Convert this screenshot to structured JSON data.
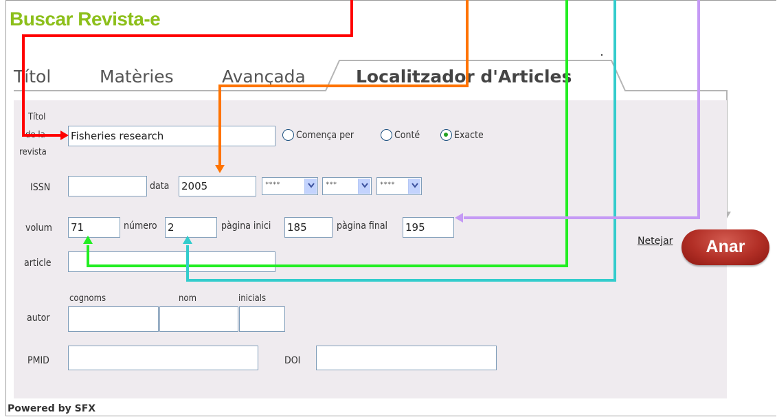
{
  "page": {
    "title": "Buscar Revista-e",
    "powered_by": "Powered by SFX"
  },
  "tabs": [
    {
      "label": "Títol",
      "active": false
    },
    {
      "label": "Matèries",
      "active": false
    },
    {
      "label": "Avançada",
      "active": false
    },
    {
      "label": "Localitzador d'Articles",
      "active": true
    }
  ],
  "form": {
    "journal_title": {
      "label_line1": "Títol",
      "label_line2": "de la",
      "label_line3": "revista",
      "value": "Fisheries research",
      "match_options": [
        "Comença per",
        "Conté",
        "Exacte"
      ],
      "match_selected": "Exacte"
    },
    "issn": {
      "label": "ISSN",
      "value": ""
    },
    "date": {
      "label": "data",
      "value": "2005",
      "year_select": "****",
      "month_select": "***",
      "day_select": "****"
    },
    "volume": {
      "label": "volum",
      "value": "71"
    },
    "issue": {
      "label": "número",
      "value": "2"
    },
    "start_page": {
      "label": "pàgina inici",
      "value": "185"
    },
    "end_page": {
      "label": "pàgina final",
      "value": "195"
    },
    "article": {
      "label": "article",
      "value": ""
    },
    "author": {
      "label": "autor",
      "surname_label": "cognoms",
      "name_label": "nom",
      "initials_label": "inicials",
      "surname": "",
      "name": "",
      "initials": ""
    },
    "pmid": {
      "label": "PMID",
      "value": ""
    },
    "doi": {
      "label": "DOI",
      "value": ""
    }
  },
  "actions": {
    "clear_label": "Netejar",
    "go_label": "Anar"
  },
  "annotation_colors": {
    "journal_title": "#ff0000",
    "date": "#ff7300",
    "volume": "#22ee22",
    "issue": "#33cccc",
    "end_page": "#c59af5",
    "tab_outline": "#b5b5b5"
  }
}
